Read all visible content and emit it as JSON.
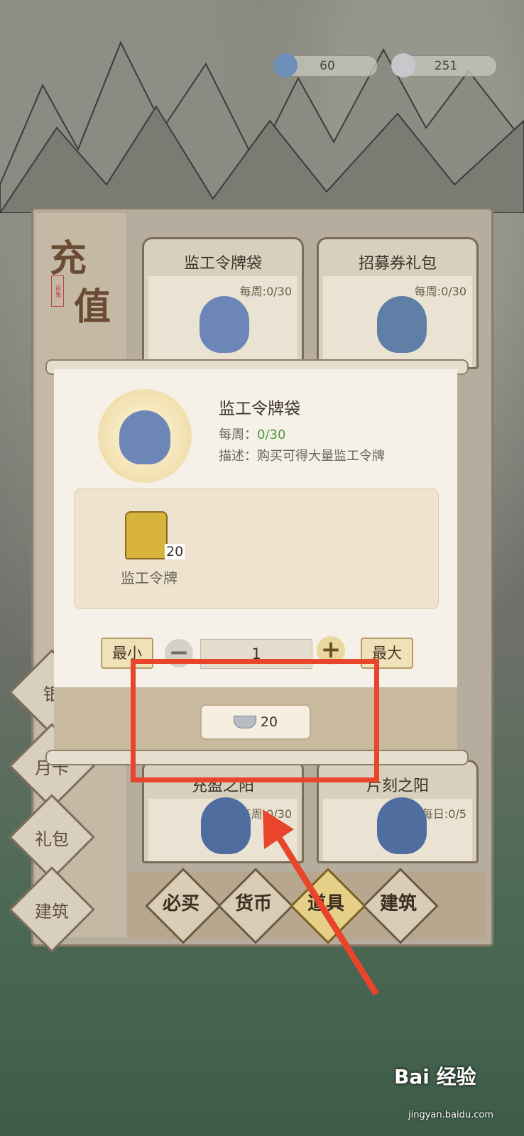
{
  "currencies": [
    {
      "name": "jade-icon",
      "value": "60"
    },
    {
      "name": "silver-ingot-icon",
      "value": "251"
    }
  ],
  "sidebar": {
    "title_chars": [
      "充",
      "值"
    ],
    "seal_text": "百鬼",
    "tabs": [
      {
        "label": "银"
      },
      {
        "label": "月卡"
      },
      {
        "label": "礼包"
      },
      {
        "label": "建筑"
      }
    ]
  },
  "cards": [
    {
      "name": "监工令牌袋",
      "quota": "每周:0/30"
    },
    {
      "name": "招募券礼包",
      "quota": "每周:0/30"
    },
    {
      "name": "充盈之阳",
      "quota": "每周:0/30"
    },
    {
      "name": "片刻之阳",
      "quota": "每日:0/5"
    }
  ],
  "categories": [
    {
      "label": "必买"
    },
    {
      "label": "货币"
    },
    {
      "label": "道具"
    },
    {
      "label": "建筑"
    }
  ],
  "popup": {
    "item_title": "监工令牌袋",
    "weekly_label": "每周：",
    "weekly_value": "0/30",
    "desc_label": "描述：",
    "desc_value": "购买可得大量监工令牌",
    "reward_name": "监工令牌",
    "reward_count": "20",
    "min_label": "最小",
    "max_label": "最大",
    "minus": "−",
    "plus": "+",
    "quantity": "1",
    "price": "20"
  },
  "watermark": {
    "brand": "Bai 经验",
    "url": "jingyan.baidu.com"
  },
  "colors": {
    "highlight": "#e8452b",
    "arrow": "#e8452b",
    "accent_green": "#4c9a3e"
  }
}
